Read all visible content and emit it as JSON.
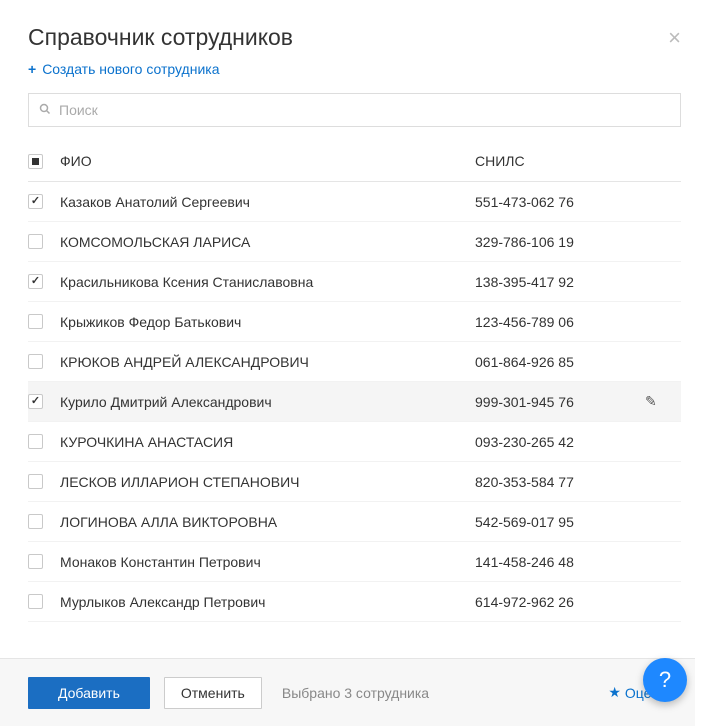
{
  "title": "Справочник сотрудников",
  "create_link": "Создать нового сотрудника",
  "search": {
    "placeholder": "Поиск"
  },
  "columns": {
    "name": "ФИО",
    "snils": "СНИЛС"
  },
  "rows": [
    {
      "name": "Казаков Анатолий Сергеевич",
      "snils": "551-473-062 76",
      "checked": true,
      "hover": false
    },
    {
      "name": "КОМСОМОЛЬСКАЯ ЛАРИСА",
      "snils": "329-786-106 19",
      "checked": false,
      "hover": false
    },
    {
      "name": "Красильникова Ксения Станиславовна",
      "snils": "138-395-417 92",
      "checked": true,
      "hover": false
    },
    {
      "name": "Крыжиков Федор Батькович",
      "snils": "123-456-789 06",
      "checked": false,
      "hover": false
    },
    {
      "name": "КРЮКОВ АНДРЕЙ АЛЕКСАНДРОВИЧ",
      "snils": "061-864-926 85",
      "checked": false,
      "hover": false
    },
    {
      "name": "Курило Дмитрий Александрович",
      "snils": "999-301-945 76",
      "checked": true,
      "hover": true
    },
    {
      "name": "КУРОЧКИНА АНАСТАСИЯ",
      "snils": "093-230-265 42",
      "checked": false,
      "hover": false
    },
    {
      "name": "ЛЕСКОВ ИЛЛАРИОН СТЕПАНОВИЧ",
      "snils": "820-353-584 77",
      "checked": false,
      "hover": false
    },
    {
      "name": "ЛОГИНОВА АЛЛА ВИКТОРОВНА",
      "snils": "542-569-017 95",
      "checked": false,
      "hover": false
    },
    {
      "name": "Монаков Константин Петрович",
      "snils": "141-458-246 48",
      "checked": false,
      "hover": false
    },
    {
      "name": "Мурлыков Александр Петрович",
      "snils": "614-972-962 26",
      "checked": false,
      "hover": false
    }
  ],
  "footer": {
    "add": "Добавить",
    "cancel": "Отменить",
    "selected": "Выбрано 3 сотрудника",
    "rate": "Оцени"
  },
  "help": "?"
}
